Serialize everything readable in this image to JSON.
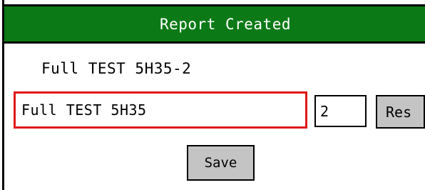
{
  "dialog": {
    "title": "Report Created",
    "report_name_label": "Full TEST 5H35-2"
  },
  "form": {
    "name_value": "Full TEST 5H35",
    "number_value": "2",
    "res_label": "Res",
    "save_label": "Save"
  },
  "colors": {
    "titlebar": "#0b7a16",
    "input_focus_border": "#e01818",
    "button_face": "#c4c4c4"
  }
}
